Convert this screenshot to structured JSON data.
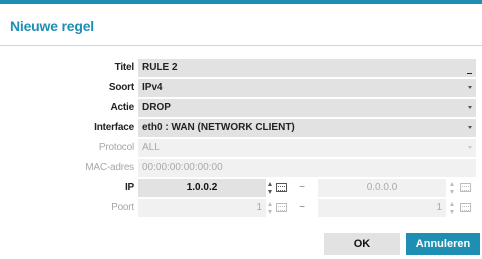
{
  "dialog": {
    "title": "Nieuwe regel"
  },
  "form": {
    "titel": {
      "label": "Titel",
      "value": "RULE 2"
    },
    "soort": {
      "label": "Soort",
      "value": "IPv4"
    },
    "actie": {
      "label": "Actie",
      "value": "DROP"
    },
    "interface": {
      "label": "Interface",
      "value": "eth0 : WAN (NETWORK CLIENT)"
    },
    "protocol": {
      "label": "Protocol",
      "value": "ALL",
      "enabled": false
    },
    "mac": {
      "label": "MAC-adres",
      "value": "00:00:00:00:00:00",
      "enabled": false
    },
    "ip": {
      "label": "IP",
      "from": "1.0.0.2",
      "separator": "~",
      "to": "0.0.0.0"
    },
    "poort": {
      "label": "Poort",
      "from": "1",
      "separator": "~",
      "to": "1",
      "enabled": false
    }
  },
  "buttons": {
    "ok": "OK",
    "cancel": "Annuleren"
  },
  "colors": {
    "accent": "#1e8fb3",
    "field_bg": "#e2e2e2",
    "field_disabled_bg": "#f1f1f1"
  }
}
